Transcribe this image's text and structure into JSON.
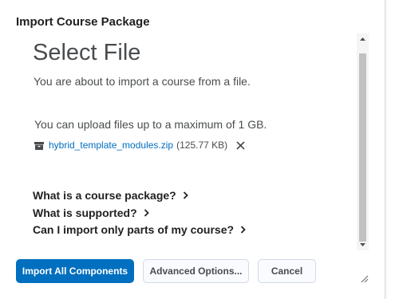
{
  "dialog": {
    "title": "Import Course Package"
  },
  "content": {
    "heading": "Select File",
    "intro": "You are about to import a course from a file.",
    "limit_text": "You can upload files up to a maximum of 1 GB.",
    "file": {
      "name": "hybrid_template_modules.zip",
      "size": "(125.77 KB)",
      "icon": "archive-icon",
      "remove_icon": "close-icon"
    },
    "faq": [
      {
        "label": "What is a course package?"
      },
      {
        "label": "What is supported?"
      },
      {
        "label": "Can I import only parts of my course?"
      }
    ]
  },
  "footer": {
    "import_all_label": "Import All Components",
    "advanced_label": "Advanced Options...",
    "cancel_label": "Cancel"
  },
  "colors": {
    "primary": "#006fbf",
    "text": "#494c4e",
    "title": "#202122"
  }
}
